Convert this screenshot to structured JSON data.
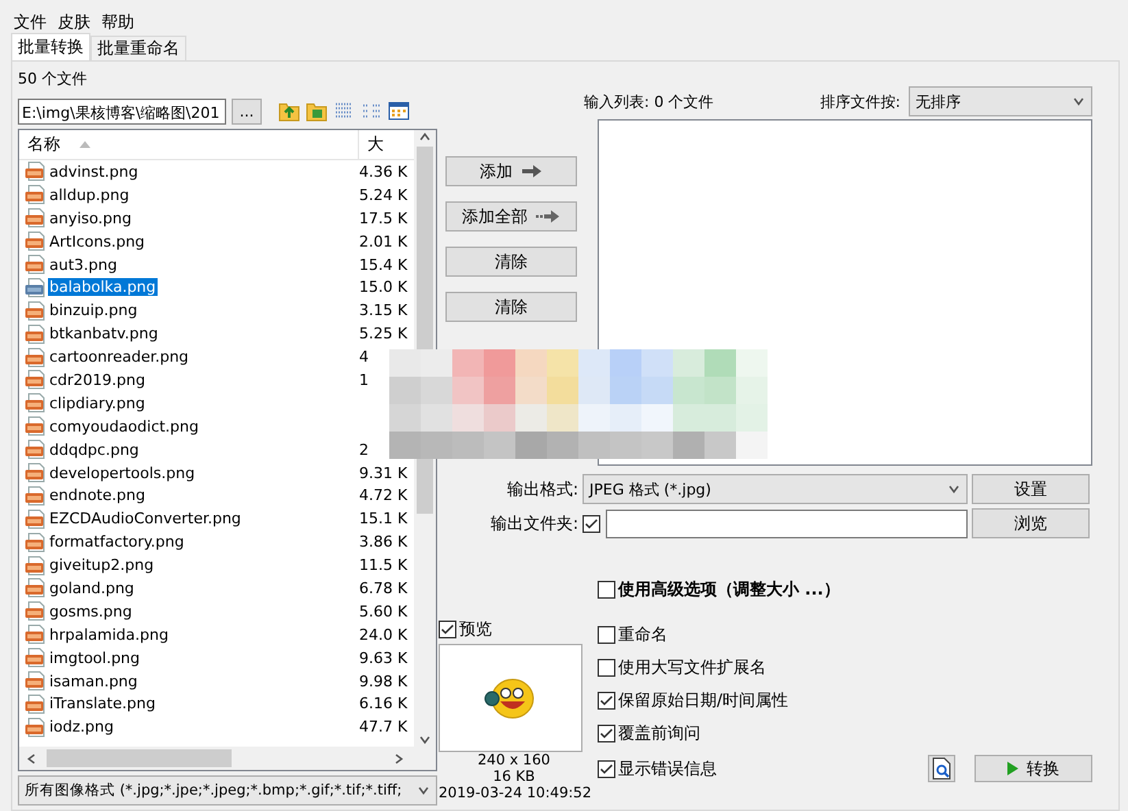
{
  "menu": [
    "文件",
    "皮肤",
    "帮助"
  ],
  "tabs": [
    {
      "label": "批量转换",
      "selected": true
    },
    {
      "label": "批量重命名",
      "selected": false
    }
  ],
  "file_count": "50 个文件",
  "path_field": {
    "value": "E:\\img\\果核博客\\缩略图\\201",
    "browse": "..."
  },
  "file_list": {
    "columns": [
      "名称",
      "大"
    ],
    "rows": [
      {
        "name": "advinst.png",
        "size": "4.36 K",
        "selected": false
      },
      {
        "name": "alldup.png",
        "size": "5.24 K",
        "selected": false
      },
      {
        "name": "anyiso.png",
        "size": "17.5 K",
        "selected": false
      },
      {
        "name": "ArtIcons.png",
        "size": "2.01 K",
        "selected": false
      },
      {
        "name": "aut3.png",
        "size": "15.4 K",
        "selected": false
      },
      {
        "name": "balabolka.png",
        "size": "15.0 K",
        "selected": true
      },
      {
        "name": "binzuip.png",
        "size": "3.15 K",
        "selected": false
      },
      {
        "name": "btkanbatv.png",
        "size": "5.25 K",
        "selected": false
      },
      {
        "name": "cartoonreader.png",
        "size": "4",
        "selected": false
      },
      {
        "name": "cdr2019.png",
        "size": "1",
        "selected": false
      },
      {
        "name": "clipdiary.png",
        "selected": false
      },
      {
        "name": "comyoudaodict.png",
        "selected": false
      },
      {
        "name": "ddqdpc.png",
        "size": "2",
        "selected": false
      },
      {
        "name": "developertools.png",
        "size": "9.31 K",
        "selected": false
      },
      {
        "name": "endnote.png",
        "size": "4.72 K",
        "selected": false
      },
      {
        "name": "EZCDAudioConverter.png",
        "size": "15.1 K",
        "selected": false
      },
      {
        "name": "formatfactory.png",
        "size": "3.86 K",
        "selected": false
      },
      {
        "name": "giveitup2.png",
        "size": "11.5 K",
        "selected": false
      },
      {
        "name": "goland.png",
        "size": "6.78 K",
        "selected": false
      },
      {
        "name": "gosms.png",
        "size": "5.60 K",
        "selected": false
      },
      {
        "name": "hrpalamida.png",
        "size": "24.0 K",
        "selected": false
      },
      {
        "name": "imgtool.png",
        "size": "9.63 K",
        "selected": false
      },
      {
        "name": "isaman.png",
        "size": "9.98 K",
        "selected": false
      },
      {
        "name": "iTranslate.png",
        "size": "6.16 K",
        "selected": false
      },
      {
        "name": "iodz.png",
        "size": "47.7 K",
        "selected": false
      }
    ]
  },
  "file_filter": "所有图像格式 (*.jpg;*.jpe;*.jpeg;*.bmp;*.gif;*.tif;*.tiff;",
  "action_buttons": [
    {
      "label": "添加",
      "kind": "add"
    },
    {
      "label": "添加全部",
      "kind": "add-all"
    },
    {
      "label": "清除",
      "kind": "clear"
    },
    {
      "label": "清除",
      "kind": "clear"
    }
  ],
  "input_list": {
    "label": "输入列表: 0 个文件"
  },
  "sort": {
    "label": "排序文件按:",
    "value": "无排序"
  },
  "output_format": {
    "label": "输出格式:",
    "value": "JPEG 格式 (*.jpg)",
    "button": "设置"
  },
  "output_folder": {
    "label": "输出文件夹:",
    "checked": true,
    "button": "浏览"
  },
  "advanced": {
    "label": "使用高级选项（调整大小 ...）",
    "checked": false
  },
  "preview": {
    "label": "预览",
    "checked": true,
    "info": [
      "240 x 160",
      "16 KB",
      "2019-03-24 10:49:52"
    ]
  },
  "options": [
    {
      "label": "重命名",
      "checked": false
    },
    {
      "label": "使用大写文件扩展名",
      "checked": false
    },
    {
      "label": "保留原始日期/时间属性",
      "checked": true
    },
    {
      "label": "覆盖前询问",
      "checked": true
    },
    {
      "label": "显示错误信息",
      "checked": true
    }
  ],
  "convert_button": "转换"
}
